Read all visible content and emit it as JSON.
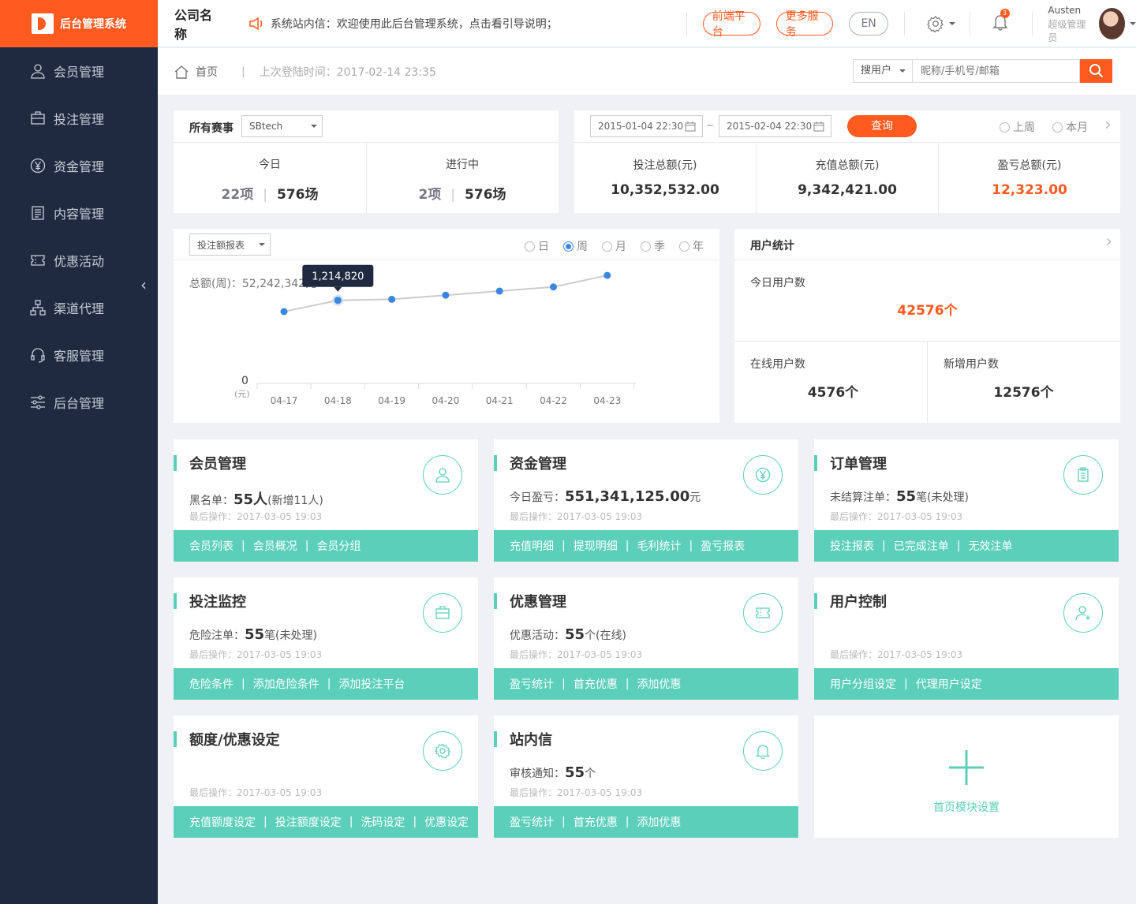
{
  "brand": {
    "name": "后台管理系统",
    "accent": "#ff5a1f",
    "sidebar_bg": "#1f2a41",
    "teal": "#5ccfbb"
  },
  "sidebar": {
    "items": [
      {
        "label": "会员管理",
        "icon": "user-icon"
      },
      {
        "label": "投注管理",
        "icon": "briefcase-icon"
      },
      {
        "label": "资金管理",
        "icon": "yen-icon"
      },
      {
        "label": "内容管理",
        "icon": "document-icon"
      },
      {
        "label": "优惠活动",
        "icon": "ticket-icon"
      },
      {
        "label": "渠道代理",
        "icon": "org-chart-icon"
      },
      {
        "label": "客服管理",
        "icon": "headset-icon"
      },
      {
        "label": "后台管理",
        "icon": "sliders-icon"
      }
    ]
  },
  "header": {
    "company": "公司名称",
    "notice": "系统站内信：欢迎使用此后台管理系统，点击看引导说明；",
    "btn_frontend": "前端平台",
    "btn_more": "更多服务",
    "btn_lang": "EN",
    "notifications": "3",
    "user_name": "Austen",
    "user_role": "超级管理员"
  },
  "breadcrumb": {
    "home": "首页",
    "last_login": "上次登陆时间：2017-02-14 23:35"
  },
  "search": {
    "type": "搜用户",
    "placeholder": "昵称/手机号/邮箱"
  },
  "events": {
    "label": "所有赛事",
    "select": "SBtech",
    "today_label": "今日",
    "today_items": "22项",
    "today_matches": "576场",
    "ongoing_label": "进行中",
    "ongoing_items": "2项",
    "ongoing_matches": "576场"
  },
  "finance": {
    "date_from": "2015-01-04  22:30",
    "date_sep": "~",
    "date_to": "2015-02-04  22:30",
    "query": "查询",
    "last_week": "上周",
    "this_month": "本月",
    "bet_label": "投注总额(元)",
    "bet_value": "10,352,532.00",
    "recharge_label": "充值总额(元)",
    "recharge_value": "9,342,421.00",
    "profit_label": "盈亏总额(元)",
    "profit_value": "12,323.00"
  },
  "chart_card": {
    "report_select": "投注额报表",
    "periods": [
      "日",
      "周",
      "月",
      "季",
      "年"
    ],
    "selected_period": "周",
    "total": "总额(周)：52,242,342元",
    "tooltip": "1,214,820",
    "y_zero": "0",
    "y_unit": "(元)"
  },
  "chart_data": {
    "type": "line",
    "x": [
      "04-17",
      "04-18",
      "04-19",
      "04-20",
      "04-21",
      "04-22",
      "04-23"
    ],
    "y": [
      1050000,
      1214820,
      1230000,
      1290000,
      1350000,
      1410000,
      1580000
    ],
    "highlight_index": 1,
    "ylim": [
      0,
      1800000
    ]
  },
  "users": {
    "title": "用户统计",
    "today_label": "今日用户数",
    "today_value": "42576个",
    "online_label": "在线用户数",
    "online_value": "4576个",
    "new_label": "新增用户数",
    "new_value": "12576个"
  },
  "modules": [
    {
      "title": "会员管理",
      "icon": "user-icon",
      "line_label": "黑名单：",
      "line_value": "55人",
      "line_suffix": "(新增11人)",
      "last": "最后操作：2017-03-05 19:03",
      "links": [
        "会员列表",
        "会员概况",
        "会员分组"
      ]
    },
    {
      "title": "资金管理",
      "icon": "yen-icon",
      "line_label": "今日盈亏：",
      "line_value": "551,341,125.00",
      "line_suffix": "元",
      "last": "最后操作：2017-03-05 19:03",
      "links": [
        "充值明细",
        "提现明细",
        "毛利统计",
        "盈亏报表"
      ]
    },
    {
      "title": "订单管理",
      "icon": "clipboard-icon",
      "line_label": "未结算注单：",
      "line_value": "55",
      "line_suffix": "笔(未处理)",
      "last": "最后操作：2017-03-05 19:03",
      "links": [
        "投注报表",
        "已完成注单",
        "无效注单"
      ]
    },
    {
      "title": "投注监控",
      "icon": "briefcase-icon",
      "line_label": "危险注单：",
      "line_value": "55",
      "line_suffix": "笔(未处理)",
      "last": "最后操作：2017-03-05 19:03",
      "links": [
        "危险条件",
        "添加危险条件",
        "添加投注平台"
      ]
    },
    {
      "title": "优惠管理",
      "icon": "ticket-icon",
      "line_label": "优惠活动：",
      "line_value": "55",
      "line_suffix": "个(在线)",
      "last": "最后操作：2017-03-05 19:03",
      "links": [
        "盈亏统计",
        "首充优惠",
        "添加优惠"
      ]
    },
    {
      "title": "用户控制",
      "icon": "user-add-icon",
      "line_label": "",
      "line_value": "",
      "line_suffix": "",
      "last": "最后操作：2017-03-05 19:03",
      "links": [
        "用户分组设定",
        "代理用户设定"
      ]
    },
    {
      "title": "额度/优惠设定",
      "icon": "gear-icon",
      "line_label": "",
      "line_value": "",
      "line_suffix": "",
      "last": "最后操作：2017-03-05 19:03",
      "links": [
        "充值额度设定",
        "投注额度设定",
        "洗码设定",
        "优惠设定"
      ]
    },
    {
      "title": "站内信",
      "icon": "bell-icon",
      "line_label": "审核通知：",
      "line_value": "55",
      "line_suffix": "个",
      "last": "最后操作：2017-03-05 19:03",
      "links": [
        "盈亏统计",
        "首充优惠",
        "添加优惠"
      ]
    }
  ],
  "add_module": {
    "label": "首页模块设置"
  }
}
